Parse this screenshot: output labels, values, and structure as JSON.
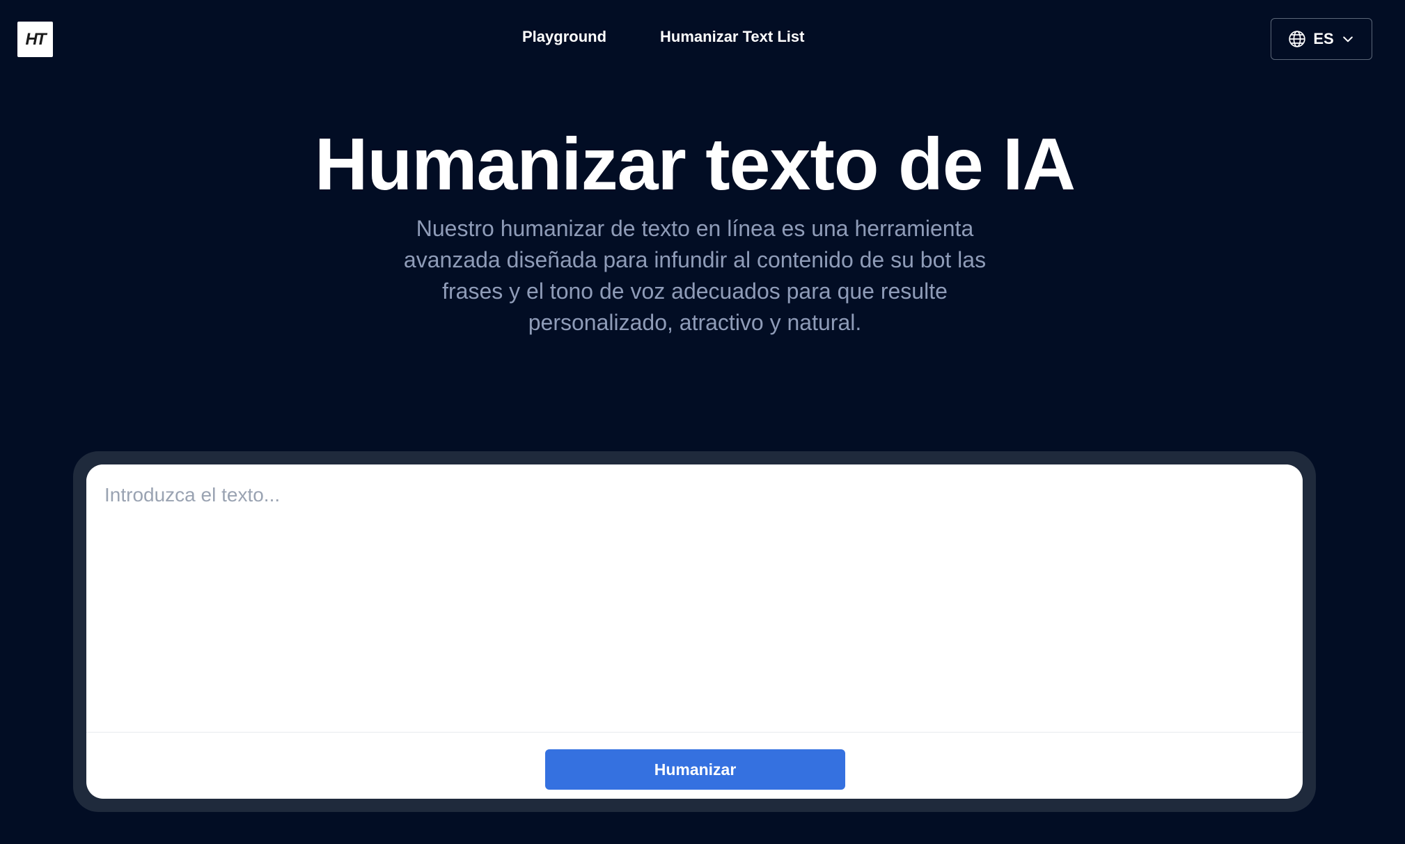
{
  "header": {
    "logo_text": "HT",
    "nav": [
      {
        "label": "Playground"
      },
      {
        "label": "Humanizar Text List"
      }
    ],
    "language": {
      "label": "ES",
      "globe_icon": "globe-icon",
      "chevron_icon": "chevron-down-icon"
    }
  },
  "hero": {
    "title": "Humanizar texto de IA",
    "description": "Nuestro humanizar de texto en línea es una herramienta avanzada diseñada para infundir al contenido de su bot las frases y el tono de voz adecuados para que resulte personalizado, atractivo y natural."
  },
  "editor": {
    "placeholder": "Introduzca el texto...",
    "value": "",
    "submit_label": "Humanizar"
  },
  "colors": {
    "background": "#020d24",
    "accent": "#3571e0",
    "frame": "#1f2a3c",
    "muted_text": "#8f9cb8"
  }
}
